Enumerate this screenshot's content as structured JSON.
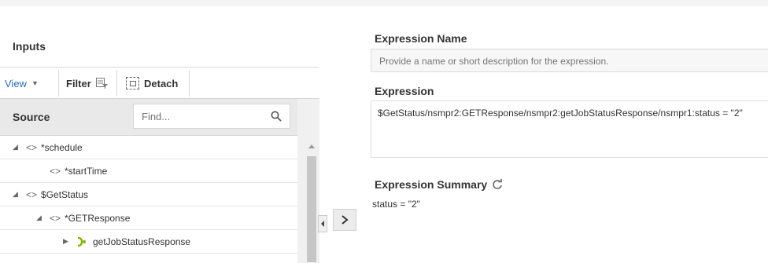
{
  "inputs": {
    "title": "Inputs",
    "toolbar": {
      "view": "View",
      "filter": "Filter",
      "detach": "Detach"
    },
    "source": {
      "label": "Source",
      "find_placeholder": "Find..."
    },
    "tree": [
      {
        "label": "*schedule"
      },
      {
        "label": "*startTime"
      },
      {
        "label": "$GetStatus"
      },
      {
        "label": "*GETResponse"
      },
      {
        "label": "getJobStatusResponse"
      }
    ]
  },
  "expression_name": {
    "label": "Expression Name",
    "placeholder": "Provide a name or short description for the expression."
  },
  "expression": {
    "label": "Expression",
    "value": "$GetStatus/nsmpr2:GETResponse/nsmpr2:getJobStatusResponse/nsmpr1:status = \"2\""
  },
  "summary": {
    "label": "Expression Summary",
    "value": "status = \"2\""
  },
  "colors": {
    "link": "#2a6ebb",
    "green_icon": "#7ab800",
    "panel_header": "#e9e9e9"
  }
}
